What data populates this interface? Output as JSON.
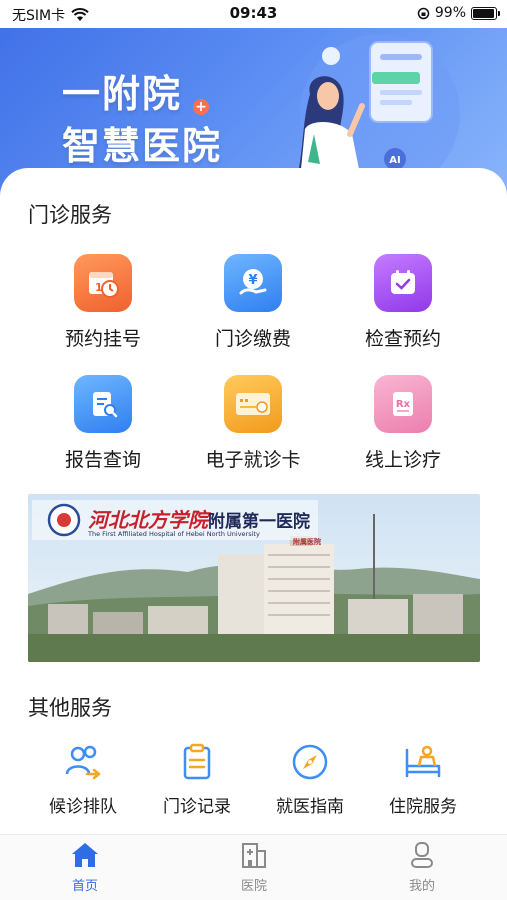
{
  "status_bar": {
    "carrier": "无SIM卡",
    "time": "09:43",
    "battery": "99%"
  },
  "hero": {
    "title_line1": "一附院",
    "title_line2": "智慧医院",
    "ai_badge": "AI"
  },
  "outpatient": {
    "title": "门诊服务",
    "items": [
      {
        "label": "预约挂号",
        "icon": "calendar-clock-icon",
        "color": "#f26a3a"
      },
      {
        "label": "门诊缴费",
        "icon": "yuan-payment-icon",
        "color": "#3d8ef5"
      },
      {
        "label": "检查预约",
        "icon": "calendar-check-icon",
        "color": "#a64bf0"
      },
      {
        "label": "报告查询",
        "icon": "report-search-icon",
        "color": "#3d8ef5"
      },
      {
        "label": "电子就诊卡",
        "icon": "medical-card-icon",
        "color": "#f5a623"
      },
      {
        "label": "线上诊疗",
        "icon": "prescription-icon",
        "color": "#ec6fa6"
      }
    ]
  },
  "banner": {
    "school_name": "河北北方学院",
    "hospital_suffix": "附属第一医院",
    "english_name": "The First Affiliated Hospital of Hebei North University",
    "rooftop_sign": "附属医院"
  },
  "other": {
    "title": "其他服务",
    "items": [
      {
        "label": "候诊排队",
        "icon": "queue-people-icon"
      },
      {
        "label": "门诊记录",
        "icon": "clipboard-icon"
      },
      {
        "label": "就医指南",
        "icon": "compass-icon"
      },
      {
        "label": "住院服务",
        "icon": "hospital-bed-icon"
      }
    ]
  },
  "tabbar": {
    "items": [
      {
        "label": "首页",
        "icon": "home-icon",
        "active": true
      },
      {
        "label": "医院",
        "icon": "hospital-building-icon",
        "active": false
      },
      {
        "label": "我的",
        "icon": "user-icon",
        "active": false
      }
    ],
    "active_color": "#2f6de8",
    "inactive_color": "#8a8a8a"
  }
}
